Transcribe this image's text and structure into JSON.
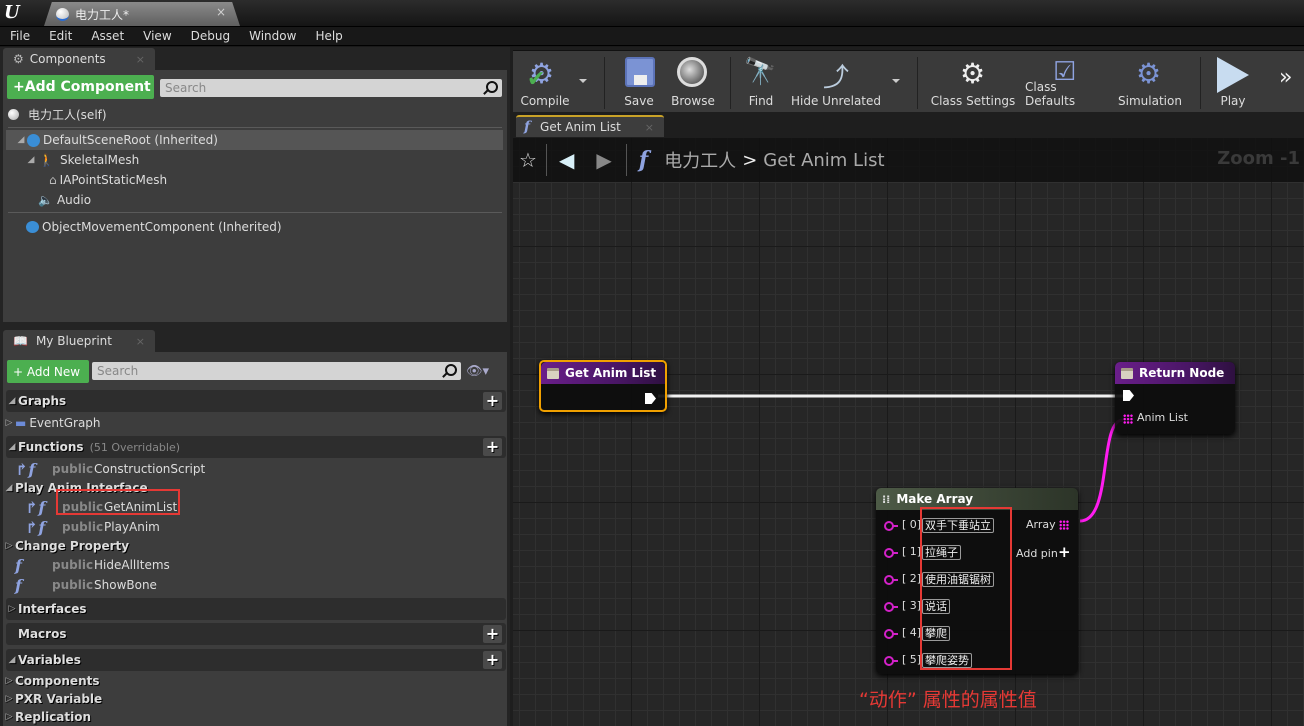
{
  "window": {
    "doc_tab_title": "电力工人*",
    "close_glyph": "×"
  },
  "menu": [
    "File",
    "Edit",
    "Asset",
    "View",
    "Debug",
    "Window",
    "Help"
  ],
  "components_panel": {
    "tab_label": "Components",
    "add_button": "+Add Component",
    "search_placeholder": "Search",
    "self_item": "电力工人(self)",
    "tree": [
      {
        "label": "DefaultSceneRoot (Inherited)",
        "icon": "scene-root-icon"
      },
      {
        "label": "SkeletalMesh",
        "icon": "skeletal-mesh-icon"
      },
      {
        "label": "IAPointStaticMesh",
        "icon": "static-mesh-icon"
      },
      {
        "label": "Audio",
        "icon": "audio-icon"
      },
      {
        "label": "ObjectMovementComponent (Inherited)",
        "icon": "movement-component-icon"
      }
    ]
  },
  "my_blueprint": {
    "tab_label": "My Blueprint",
    "add_button": "+ Add New",
    "search_placeholder": "Search",
    "graphs_header": "Graphs",
    "event_graph": "EventGraph",
    "functions_header": "Functions",
    "functions_note": "(51 Overridable)",
    "construction": {
      "access": "public",
      "name": "ConstructionScript"
    },
    "play_anim_interface": "Play Anim Interface",
    "interface_functions": [
      {
        "access": "public",
        "name": "GetAnimList"
      },
      {
        "access": "public",
        "name": "PlayAnim"
      }
    ],
    "change_property": "Change Property",
    "change_property_functions": [
      {
        "access": "public",
        "name": "HideAllItems"
      },
      {
        "access": "public",
        "name": "ShowBone"
      }
    ],
    "interfaces_header": "Interfaces",
    "macros_header": "Macros",
    "variables_header": "Variables",
    "variable_categories": [
      "Components",
      "PXR Variable",
      "Replication"
    ]
  },
  "toolbar": {
    "buttons": [
      "Compile",
      "Save",
      "Browse",
      "Find",
      "Hide Unrelated",
      "Class Settings",
      "Class Defaults",
      "Simulation",
      "Play"
    ],
    "overflow": "»"
  },
  "graph_tab": {
    "label": "Get Anim List"
  },
  "breadcrumb": {
    "root": "电力工人",
    "separator": ">",
    "current": "Get Anim List"
  },
  "zoom_label": "Zoom -1",
  "nodes": {
    "entry": {
      "title": "Get Anim List"
    },
    "return": {
      "title": "Return Node",
      "pin": "Anim List"
    },
    "make_array": {
      "title": "Make Array",
      "output": "Array",
      "add_pin": "Add pin",
      "items": [
        {
          "index": "[ 0]",
          "value": "双手下垂站立"
        },
        {
          "index": "[ 1]",
          "value": "拉绳子"
        },
        {
          "index": "[ 2]",
          "value": "使用油锯锯树"
        },
        {
          "index": "[ 3]",
          "value": "说话"
        },
        {
          "index": "[ 4]",
          "value": "攀爬"
        },
        {
          "index": "[ 5]",
          "value": "攀爬姿势"
        }
      ]
    }
  },
  "annotation": "“动作” 属性的属性值",
  "colors": {
    "accent_green": "#4caf50",
    "highlight_red": "#e53935",
    "array_pin": "#ff1cf0",
    "function_purple": "#6a1e8a",
    "selected_orange": "#f0a000"
  }
}
